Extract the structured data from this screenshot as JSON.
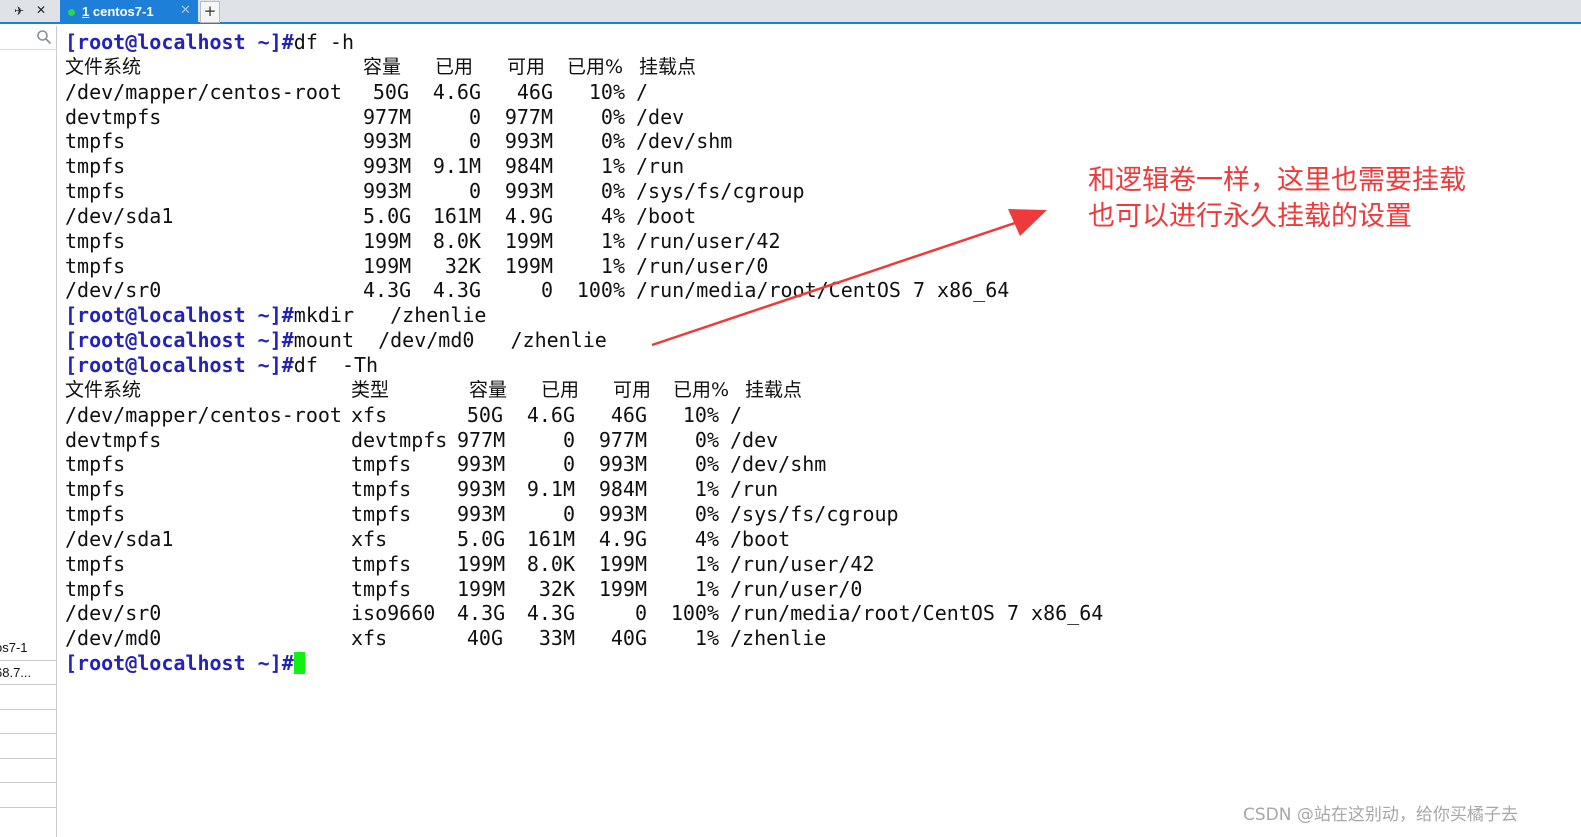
{
  "tabbar": {
    "pin_glyph": "✈",
    "close_glyph": "✕",
    "active_tab": {
      "number": "1",
      "title": "centos7-1"
    },
    "new_tab_label": "+"
  },
  "sidebar": {
    "rows": [
      "os7-1",
      "68.7...",
      "",
      "",
      "",
      "",
      ""
    ]
  },
  "terminal": {
    "prompt": "[root@localhost ~]#",
    "cmd1": "df -h",
    "df1_header": [
      "文件系统",
      "容量",
      "已用",
      "可用",
      "已用%",
      "挂载点"
    ],
    "df1_rows": [
      [
        "/dev/mapper/centos-root",
        "50G",
        "4.6G",
        "46G",
        "10%",
        "/"
      ],
      [
        "devtmpfs",
        "977M",
        "0",
        "977M",
        "0%",
        "/dev"
      ],
      [
        "tmpfs",
        "993M",
        "0",
        "993M",
        "0%",
        "/dev/shm"
      ],
      [
        "tmpfs",
        "993M",
        "9.1M",
        "984M",
        "1%",
        "/run"
      ],
      [
        "tmpfs",
        "993M",
        "0",
        "993M",
        "0%",
        "/sys/fs/cgroup"
      ],
      [
        "/dev/sda1",
        "5.0G",
        "161M",
        "4.9G",
        "4%",
        "/boot"
      ],
      [
        "tmpfs",
        "199M",
        "8.0K",
        "199M",
        "1%",
        "/run/user/42"
      ],
      [
        "tmpfs",
        "199M",
        "32K",
        "199M",
        "1%",
        "/run/user/0"
      ],
      [
        "/dev/sr0",
        "4.3G",
        "4.3G",
        "0",
        "100%",
        "/run/media/root/CentOS 7 x86_64"
      ]
    ],
    "cmd2": "mkdir   /zhenlie",
    "cmd3": "mount  /dev/md0   /zhenlie",
    "cmd4": "df  -Th",
    "df2_header": [
      "文件系统",
      "类型",
      "容量",
      "已用",
      "可用",
      "已用%",
      "挂载点"
    ],
    "df2_rows": [
      [
        "/dev/mapper/centos-root",
        "xfs",
        "50G",
        "4.6G",
        "46G",
        "10%",
        "/"
      ],
      [
        "devtmpfs",
        "devtmpfs",
        "977M",
        "0",
        "977M",
        "0%",
        "/dev"
      ],
      [
        "tmpfs",
        "tmpfs",
        "993M",
        "0",
        "993M",
        "0%",
        "/dev/shm"
      ],
      [
        "tmpfs",
        "tmpfs",
        "993M",
        "9.1M",
        "984M",
        "1%",
        "/run"
      ],
      [
        "tmpfs",
        "tmpfs",
        "993M",
        "0",
        "993M",
        "0%",
        "/sys/fs/cgroup"
      ],
      [
        "/dev/sda1",
        "xfs",
        "5.0G",
        "161M",
        "4.9G",
        "4%",
        "/boot"
      ],
      [
        "tmpfs",
        "tmpfs",
        "199M",
        "8.0K",
        "199M",
        "1%",
        "/run/user/42"
      ],
      [
        "tmpfs",
        "tmpfs",
        "199M",
        "32K",
        "199M",
        "1%",
        "/run/user/0"
      ],
      [
        "/dev/sr0",
        "iso9660",
        "4.3G",
        "4.3G",
        "0",
        "100%",
        "/run/media/root/CentOS 7 x86_64"
      ],
      [
        "/dev/md0",
        "xfs",
        "40G",
        "33M",
        "40G",
        "1%",
        "/zhenlie"
      ]
    ]
  },
  "annotation": {
    "line1": "和逻辑卷一样，这里也需要挂载",
    "line2": "也可以进行永久挂载的设置",
    "color": "#ee3a3a"
  },
  "watermark": "CSDN @站在这别动，给你买橘子去",
  "colors": {
    "tab_accent": "#1e7fd8",
    "prompt": "#2323b8",
    "cursor": "#12f012",
    "status_dot": "#21d94a"
  }
}
